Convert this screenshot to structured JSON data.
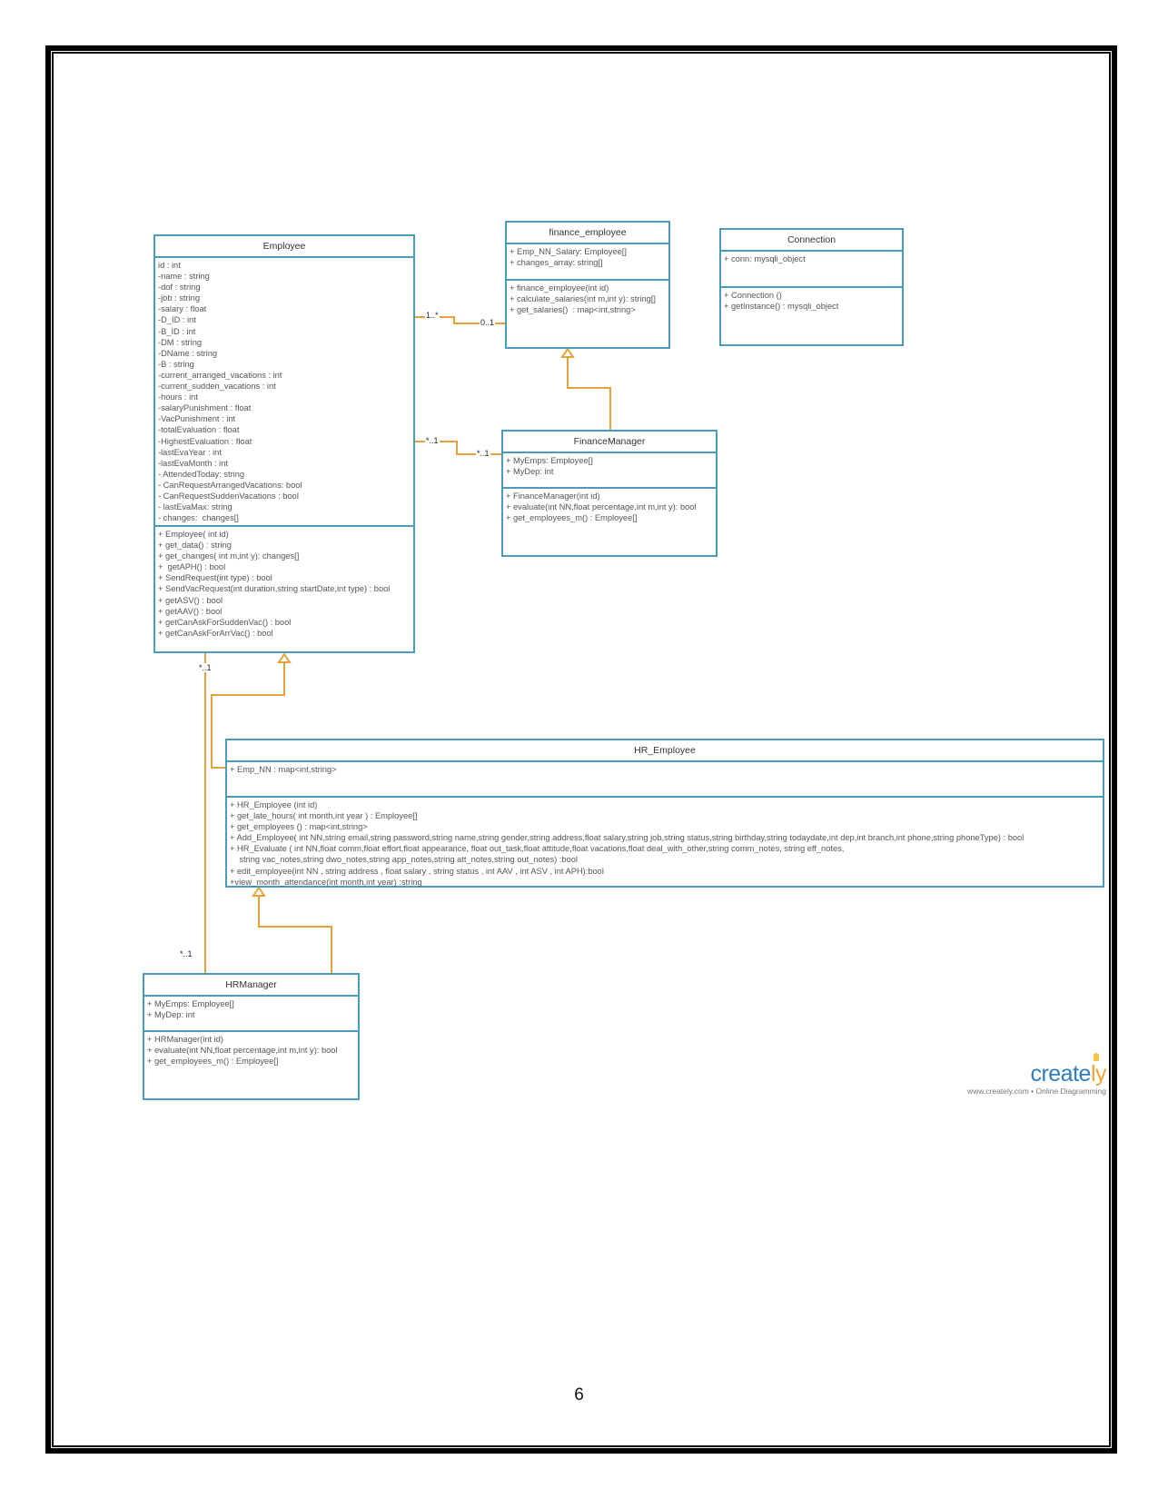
{
  "diagram": {
    "classes": {
      "employee": {
        "name": "Employee",
        "attributes": [
          "id : int",
          "-name : string",
          "-dof : string",
          "-job : string",
          "-salary : float",
          "-D_ID : int",
          "-B_ID : int",
          "-DM : string",
          "-DName : string",
          "-B : string",
          "-current_arranged_vacations : int",
          "-current_sudden_vacations : int",
          "-hours : int",
          "-salaryPunishment : float",
          "-VacPunishment : int",
          "-totalEvaluation : float",
          "-HighestEvaluation : float",
          "-lastEvaYear : int",
          "-lastEvaMonth : int",
          "- AttendedToday: string",
          "- CanRequestArrangedVacations: bool",
          "- CanRequestSuddenVacations : bool",
          "- lastEvaMax: string",
          "- changes:  changes[]"
        ],
        "methods": [
          "+ Employee( int id)",
          "+ get_data() : string",
          "+ get_changes( int m,int y): changes[]",
          "+  getAPH() : bool",
          "+ SendRequest(int type) : bool",
          "+ SendVacRequest(int duration,string startDate,int type) : bool",
          "+ getASV() : bool",
          "+ getAAV() : bool",
          "+ getCanAskForSuddenVac() : bool",
          "+ getCanAskForArrVac() : bool"
        ]
      },
      "finance_employee": {
        "name": "finance_employee",
        "attributes": [
          "+ Emp_NN_Salary: Employee[]",
          "+ changes_array: string[]"
        ],
        "methods": [
          "+ finance_employee(int id)",
          "+ calculate_salaries(int m,int y): string[]",
          "+ get_salaries()  : map<int,string>"
        ]
      },
      "connection": {
        "name": "Connection",
        "attributes": [
          "+ conn: mysqli_object"
        ],
        "methods": [
          "+ Connection ()",
          "+ getInstance() : mysqli_object"
        ]
      },
      "finance_manager": {
        "name": "FinanceManager",
        "attributes": [
          "+ MyEmps: Employee[]",
          "+ MyDep: int"
        ],
        "methods": [
          "+ FinanceManager(int id)",
          "+ evaluate(int NN,float percentage,int m,int y): bool",
          "+ get_employees_m() : Employee[]"
        ]
      },
      "hr_employee": {
        "name": "HR_Employee",
        "attributes": [
          "+ Emp_NN : map<int,string>"
        ],
        "methods": [
          "+ HR_Employee (int id)",
          "+ get_late_hours( int month,int year ) : Employee[]",
          "+ get_employees () : map<int,string>",
          "+ Add_Employee( int NN,string email,string password,string name,string gender,string address,float salary,string job,string status,string birthday,string todaydate,int dep,int branch,int phone,string phoneType) : bool",
          "+ HR_Evaluate ( int NN,float comm,float effort,float appearance, float out_task,float attitude,float vacations,float deal_with_other,string comm_notes, string eff_notes,",
          "    string vac_notes,string dwo_notes,string app_notes,string att_notes,string out_notes) :bool",
          "+ edit_employee(int NN , string address , float salary , string status , int AAV , int ASV , int APH):bool",
          "+view_month_attendance(int month,int year) :string"
        ]
      },
      "hr_manager": {
        "name": "HRManager",
        "attributes": [
          "+ MyEmps: Employee[]",
          "+ MyDep: int"
        ],
        "methods": [
          "+ HRManager(int id)",
          "+ evaluate(int NN,float percentage,int m,int y): bool",
          "+ get_employees_m() : Employee[]"
        ]
      }
    },
    "multiplicities": {
      "emp_fin_emp_side": "1..*",
      "emp_fin_fin_side": "0..1",
      "emp_finmgr_emp_side": "*..1",
      "emp_finmgr_mgr_side": "*..1",
      "emp_hrmgr_emp_side": "*..1",
      "emp_hrmgr_mgr_side": "*..1"
    },
    "colors": {
      "class_border": "#4a9cbf",
      "connector": "#e3a33b"
    }
  },
  "watermark": {
    "brand_main": "create",
    "brand_accent": "ly",
    "tagline": "www.creately.com • Online Diagramming"
  },
  "page": {
    "number": "6"
  }
}
